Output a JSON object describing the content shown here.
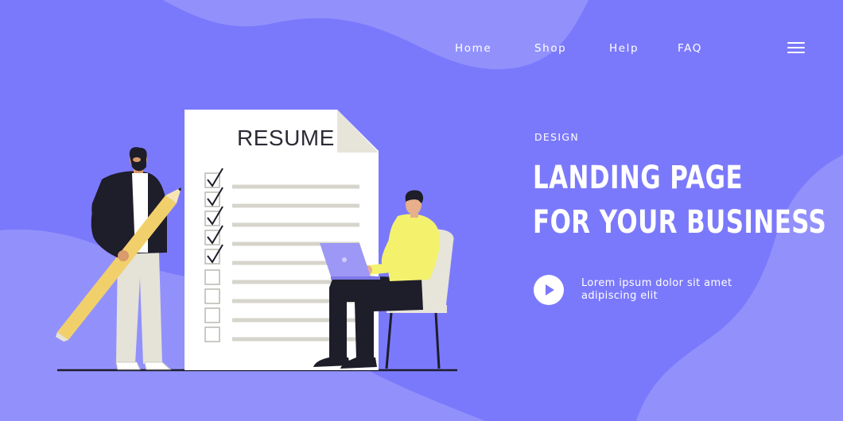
{
  "nav": {
    "items": [
      "Home",
      "Shop",
      "Help",
      "FAQ"
    ],
    "menu_icon": "hamburger-menu-icon"
  },
  "hero": {
    "eyebrow": "DESIGN",
    "headline_line1": "LANDING PAGE",
    "headline_line2": "FOR YOUR BUSINESS",
    "tagline_line1": "Lorem ipsum dolor sit amet",
    "tagline_line2": "adipiscing elit",
    "play_icon": "play-icon"
  },
  "illustration": {
    "document_title": "RESUME",
    "checked_items": 5,
    "unchecked_items": 4
  },
  "colors": {
    "background": "#7b79fb",
    "blob": "#9291fc",
    "text": "#ffffff",
    "shirt_yellow": "#f4f26d",
    "pencil": "#f1d06c"
  }
}
